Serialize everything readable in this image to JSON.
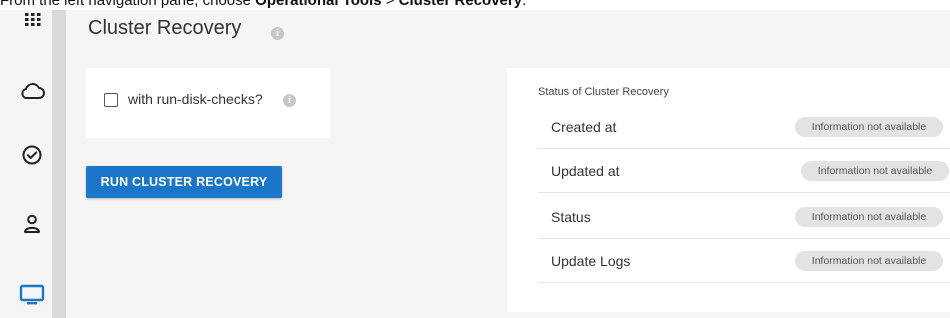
{
  "caption": {
    "prefix": "From the left navigation pane, choose ",
    "menu": "Operational Tools",
    "separator": " > ",
    "item": "Cluster Recovery",
    "suffix": "."
  },
  "sidebar": {
    "items": [
      {
        "icon": "apps-grid-icon"
      },
      {
        "icon": "cloud-icon"
      },
      {
        "icon": "check-circle-icon"
      },
      {
        "icon": "user-icon"
      },
      {
        "icon": "monitor-icon",
        "active": true
      }
    ]
  },
  "page": {
    "title": "Cluster Recovery",
    "info_glyph": "i"
  },
  "options": {
    "checkbox_label": "with run-disk-checks?",
    "checked": false,
    "info_glyph": "i"
  },
  "actions": {
    "run_label": "RUN CLUSTER RECOVERY"
  },
  "status": {
    "heading": "Status of Cluster Recovery",
    "rows": [
      {
        "label": "Created at",
        "value": "Information not available"
      },
      {
        "label": "Updated at",
        "value": "Information not available"
      },
      {
        "label": "Status",
        "value": "Information not available"
      },
      {
        "label": "Update Logs",
        "value": "Information not available"
      }
    ]
  },
  "colors": {
    "primary": "#1976c9",
    "active_icon": "#1976c9",
    "icon": "#222222",
    "badge_bg": "#e3e3e3"
  }
}
